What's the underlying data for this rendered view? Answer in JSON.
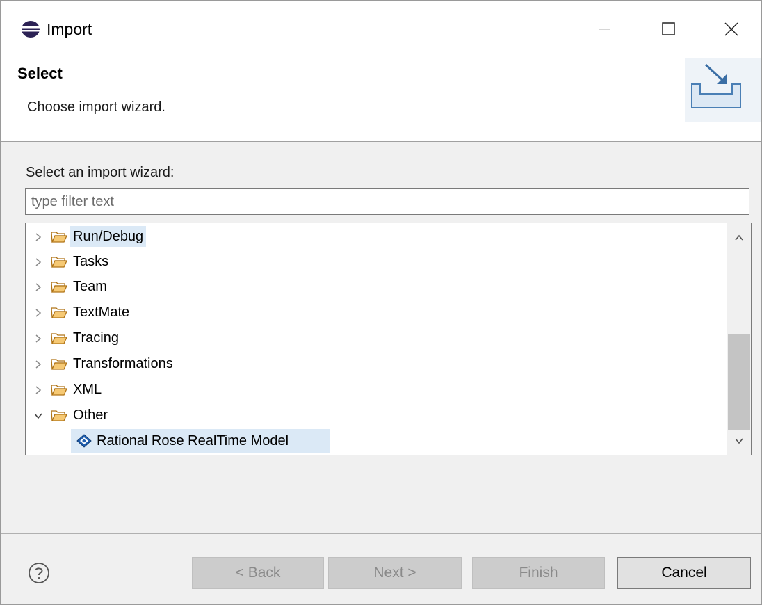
{
  "window": {
    "title": "Import"
  },
  "header": {
    "title": "Select",
    "description": "Choose import wizard."
  },
  "wizard": {
    "select_label": "Select an import wizard:",
    "filter_placeholder": "type filter text",
    "filter_value": ""
  },
  "tree": {
    "items": [
      {
        "label": "Run/Debug",
        "icon": "folder-icon",
        "expanded": false,
        "selected": true
      },
      {
        "label": "Tasks",
        "icon": "folder-icon",
        "expanded": false
      },
      {
        "label": "Team",
        "icon": "folder-icon",
        "expanded": false
      },
      {
        "label": "TextMate",
        "icon": "folder-icon",
        "expanded": false
      },
      {
        "label": "Tracing",
        "icon": "folder-icon",
        "expanded": false
      },
      {
        "label": "Transformations",
        "icon": "folder-icon",
        "expanded": false
      },
      {
        "label": "XML",
        "icon": "folder-icon",
        "expanded": false
      },
      {
        "label": "Other",
        "icon": "folder-icon",
        "expanded": true
      }
    ],
    "leaf": {
      "label": "Rational Rose RealTime Model",
      "icon": "rose-model-icon",
      "selected": true
    }
  },
  "buttons": {
    "back": "< Back",
    "next": "Next >",
    "finish": "Finish",
    "cancel": "Cancel"
  },
  "colors": {
    "selection": "#dbe9f6",
    "folder": "#e8a23c",
    "disabled_button": "#cccccc"
  }
}
